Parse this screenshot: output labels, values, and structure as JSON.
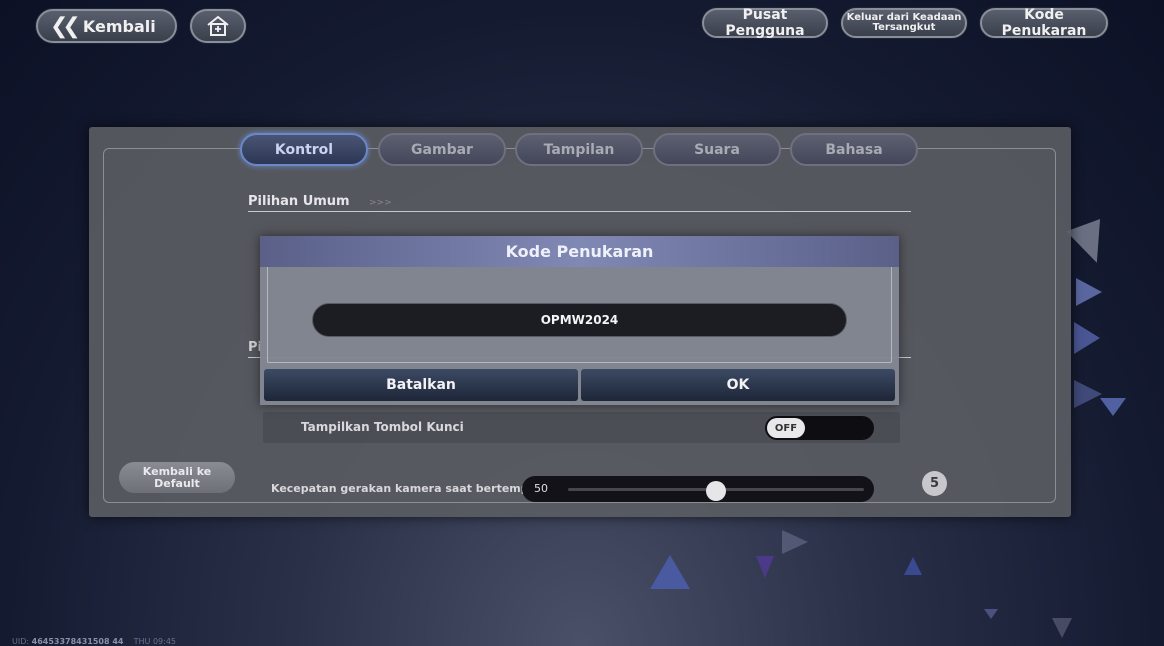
{
  "top_bar": {
    "back_label": "Kembali",
    "user_center_label": "Pusat Pengguna",
    "stuck_label": "Keluar dari Keadaan Tersangkut",
    "redeem_label": "Kode Penukaran"
  },
  "tabs": [
    {
      "label": "Kontrol",
      "active": true
    },
    {
      "label": "Gambar",
      "active": false
    },
    {
      "label": "Tampilan",
      "active": false
    },
    {
      "label": "Suara",
      "active": false
    },
    {
      "label": "Bahasa",
      "active": false
    }
  ],
  "settings": {
    "section_general": "Pilihan Umum",
    "section_general_arrows": ">>>",
    "section_second_fragment": "Pi",
    "lock_row_label": "Tampilkan Tombol Kunci",
    "lock_toggle_value": "OFF",
    "camera_row_label": "Kecepatan gerakan kamera saat bertempur",
    "camera_value": "50",
    "camera_fraction": 0.5,
    "hint_badge": "5",
    "default_label": "Kembali ke Default"
  },
  "modal": {
    "title": "Kode Penukaran",
    "code_value": "OPMW2024",
    "cancel_label": "Batalkan",
    "ok_label": "OK"
  },
  "footer": {
    "uid_prefix": "UID:",
    "uid_value": "46453378431508 44",
    "time": "THU 09:45"
  },
  "colors": {
    "accent_tab": "#6a88c8",
    "modal_header": "#8088b4"
  }
}
